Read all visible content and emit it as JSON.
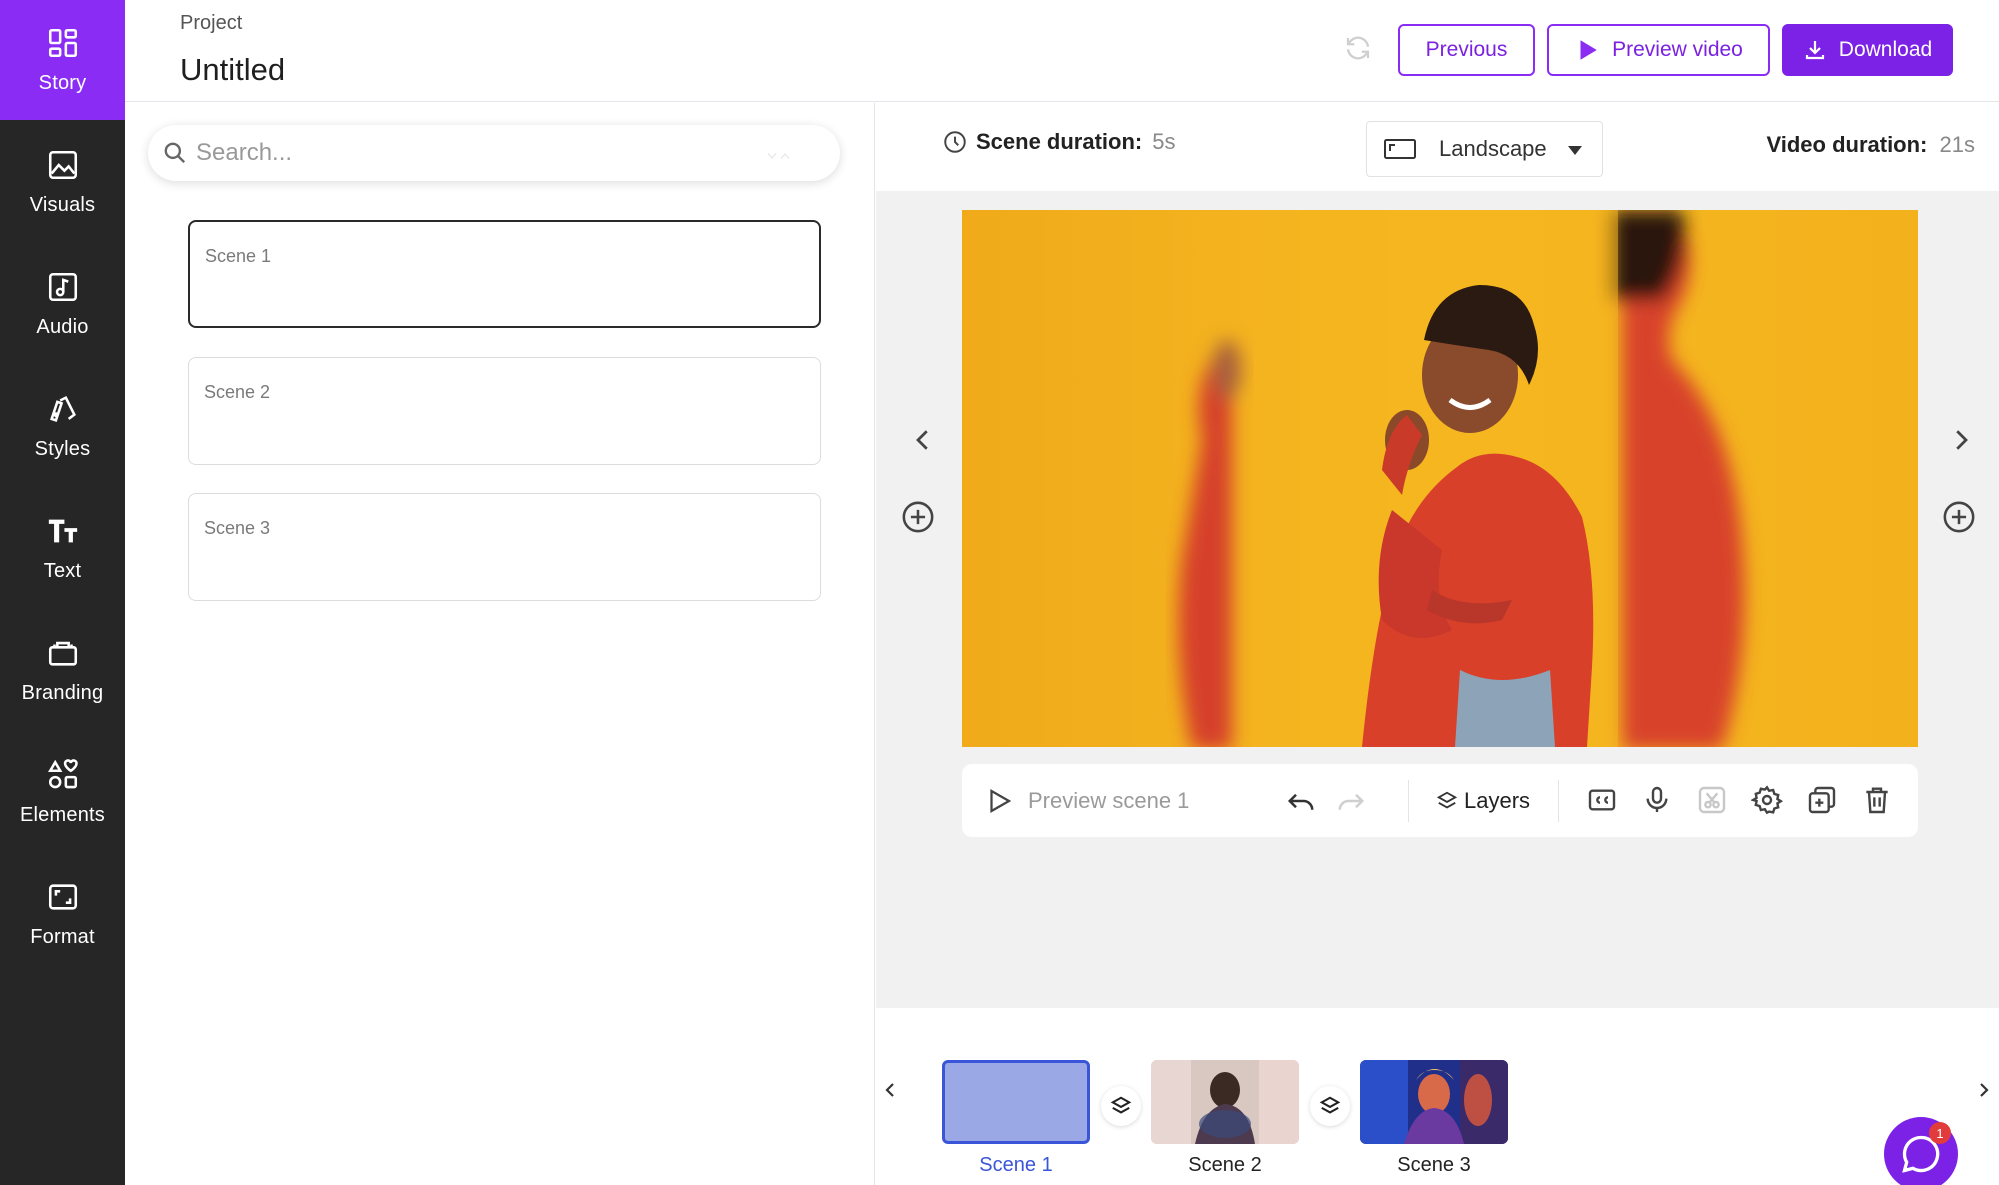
{
  "sidebar": {
    "items": [
      {
        "label": "Story",
        "icon": "story-icon",
        "active": true
      },
      {
        "label": "Visuals",
        "icon": "image-icon"
      },
      {
        "label": "Audio",
        "icon": "music-note-icon"
      },
      {
        "label": "Styles",
        "icon": "styles-icon"
      },
      {
        "label": "Text",
        "icon": "text-icon"
      },
      {
        "label": "Branding",
        "icon": "briefcase-icon"
      },
      {
        "label": "Elements",
        "icon": "shapes-icon"
      },
      {
        "label": "Format",
        "icon": "frame-icon"
      }
    ]
  },
  "header": {
    "kicker": "Project",
    "title": "Untitled",
    "previous_label": "Previous",
    "preview_label": "Preview video",
    "download_label": "Download"
  },
  "search": {
    "placeholder": "Search...",
    "value": ""
  },
  "scenes": [
    {
      "label": "Scene 1",
      "active": true
    },
    {
      "label": "Scene 2"
    },
    {
      "label": "Scene 3"
    }
  ],
  "infobar": {
    "scene_duration_label": "Scene duration:",
    "scene_duration_value": "5s",
    "orientation": "Landscape",
    "video_duration_label": "Video duration:",
    "video_duration_value": "21s"
  },
  "toolbar": {
    "preview_scene_label": "Preview scene 1",
    "layers_label": "Layers"
  },
  "timeline": {
    "thumbs": [
      {
        "label": "Scene 1",
        "active": true
      },
      {
        "label": "Scene 2"
      },
      {
        "label": "Scene 3"
      }
    ]
  },
  "chat": {
    "badge": "1"
  },
  "colors": {
    "accent": "#7c21e6",
    "rail_bg": "#262626",
    "active_rail": "#8b2cf5",
    "timeline_active": "#3a55d8",
    "canvas_bg": "#f3b31e"
  }
}
